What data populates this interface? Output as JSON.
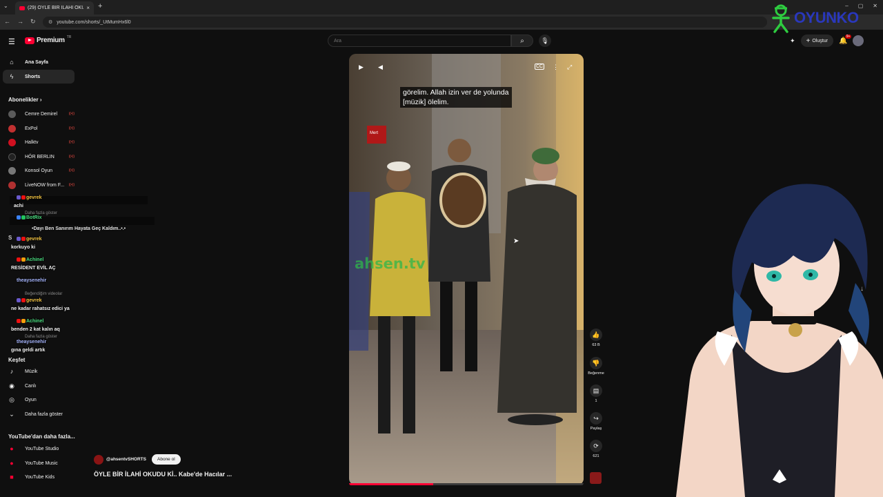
{
  "browser": {
    "tab_title": "(29) ÖYLE BİR İLAHİ OKUDU Kİ..",
    "url": "youtube.com/shorts/_UtMumHx6l0",
    "new_tab": "+",
    "tab_close": "×"
  },
  "header": {
    "logo_text": "Premium",
    "logo_region": "TR",
    "search_placeholder": "Ara",
    "create_label": "Oluştur",
    "notifications_badge": "9+"
  },
  "watermark": {
    "text": "OYUNKO"
  },
  "sidebar": {
    "items": [
      {
        "label": "Ana Sayfa",
        "icon": "home-icon"
      },
      {
        "label": "Shorts",
        "icon": "shorts-icon"
      }
    ],
    "subscriptions_heading": "Abonelikler",
    "subscriptions": [
      {
        "name": "Cemre Demirel",
        "color": "#5a5a5a"
      },
      {
        "name": "ExPol",
        "color": "#c03030"
      },
      {
        "name": "Halktv",
        "color": "#d01020"
      },
      {
        "name": "HÖR BERLIN",
        "color": "#222222"
      },
      {
        "name": "Konsol Oyun",
        "color": "#777777"
      },
      {
        "name": "LiveNOW from F...",
        "color": "#b03030"
      }
    ],
    "partial_labels": {
      "more": "Daha fazla göster",
      "s_head": "S",
      "liked": "Beğendiğim videolar",
      "more2": "Daha fazla göster"
    },
    "explore_heading": "Keşfet",
    "explore": [
      {
        "label": "Müzik",
        "icon": "music-icon"
      },
      {
        "label": "Canlı",
        "icon": "live-icon"
      },
      {
        "label": "Oyun",
        "icon": "gaming-icon"
      },
      {
        "label": "Daha fazla göster",
        "icon": "chevron-down-icon"
      }
    ],
    "more_from_heading": "YouTube'dan daha fazla...",
    "more_from": [
      {
        "label": "YouTube Studio"
      },
      {
        "label": "YouTube Music"
      },
      {
        "label": "YouTube Kids"
      }
    ]
  },
  "chat": [
    {
      "user": "gevrek",
      "color": "#f5c542",
      "message": "achi"
    },
    {
      "user": "BotRix",
      "color": "#4ade80",
      "message": "•Dayı Ben Sanırım Hayata Geç Kaldım..•.•"
    },
    {
      "user": "gevrek",
      "color": "#f5c542",
      "message": "korkuyo ki"
    },
    {
      "user": "Achinel",
      "color": "#4ade80",
      "message": "RESİDENT EVİL AÇ"
    },
    {
      "user": "theaysenehir",
      "color": "#a5b4fc",
      "message": ""
    },
    {
      "user": "gevrek",
      "color": "#f5c542",
      "message": "ne kadar rahatsız edici ya"
    },
    {
      "user": "Achinel",
      "color": "#4ade80",
      "message": "benden 2 kat kalın aq"
    },
    {
      "user": "theaysenehir",
      "color": "#a5b4fc",
      "message": "gına geldi artık"
    }
  ],
  "video": {
    "caption_line1": "görelim. Allah izin ver de yolunda",
    "caption_line2": "[müzik] ölelim.",
    "watermark": "ahsen.tv",
    "sign_text": "Mert",
    "progress": 0.36
  },
  "actions": [
    {
      "label": "63 B",
      "icon": "like-icon"
    },
    {
      "label": "Beğenme",
      "icon": "dislike-icon"
    },
    {
      "label": "1",
      "icon": "comment-icon"
    },
    {
      "label": "Paylaş",
      "icon": "share-icon"
    },
    {
      "label": "621",
      "icon": "remix-icon"
    }
  ],
  "channel": {
    "handle": "@ahsentvSHORTS",
    "subscribe_label": "Abone ol",
    "title": "ÖYLE BİR İLAHİ OKUDU Kİ.. Kabe'de Hacılar ..."
  },
  "colors": {
    "accent": "#ff0033",
    "background": "#0f0f0f"
  }
}
